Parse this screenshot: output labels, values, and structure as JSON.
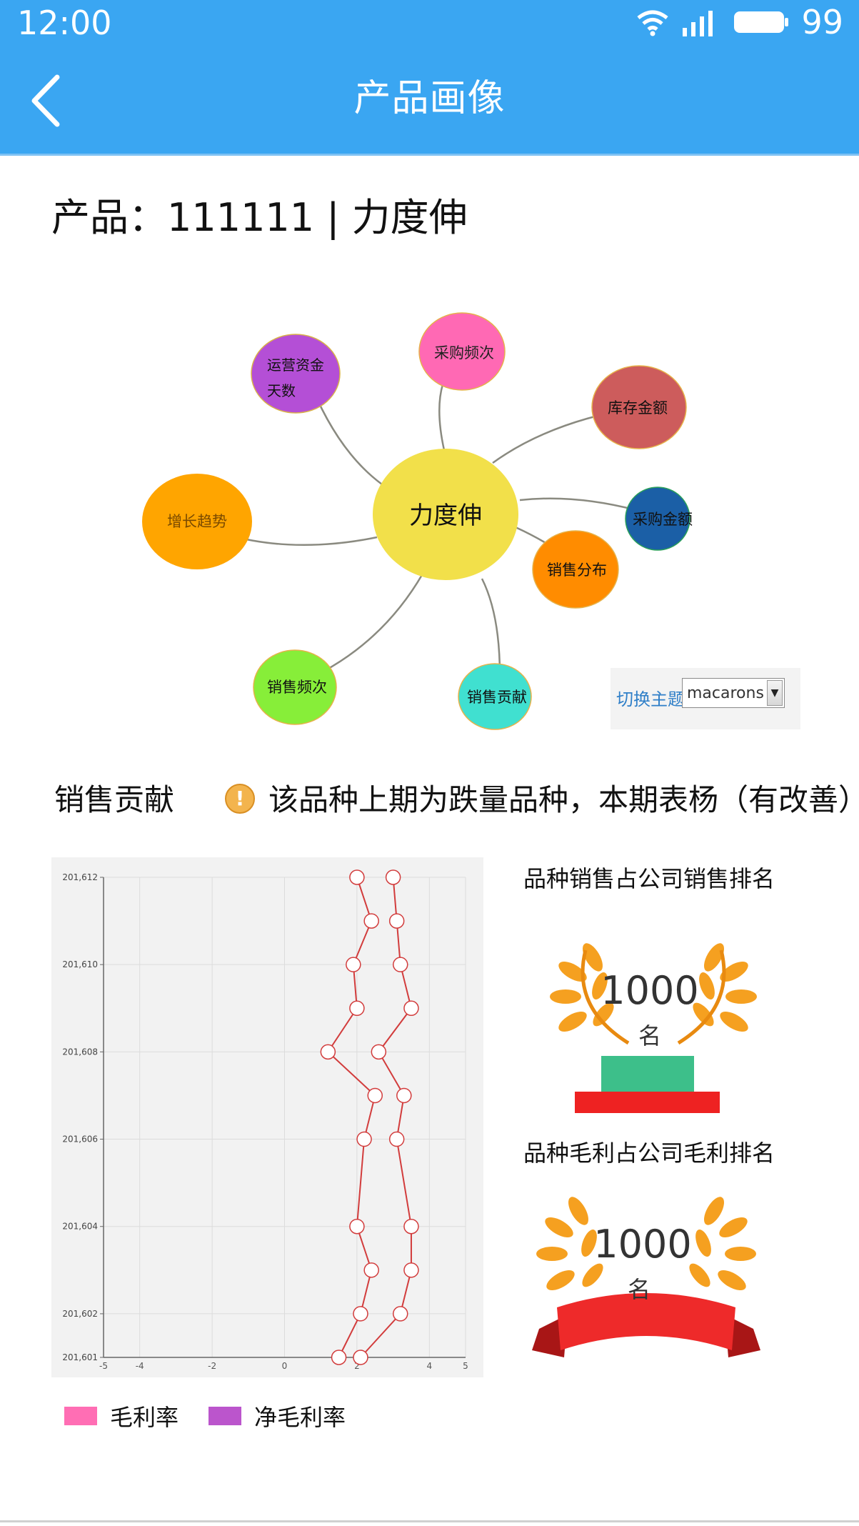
{
  "status_bar": {
    "time": "12:00",
    "battery": "99",
    "icons": [
      "wifi-icon",
      "signal-icon",
      "battery-icon"
    ]
  },
  "nav": {
    "title": "产品画像",
    "back_icon": "chevron-left-icon"
  },
  "product": {
    "prefix": "产品：",
    "code": "111111",
    "separator": " | ",
    "name": "力度伸"
  },
  "graph": {
    "center": "力度伸",
    "nodes": [
      {
        "label": "运营资金天数",
        "color": "#b44fd6"
      },
      {
        "label": "采购频次",
        "color": "#ff69b4"
      },
      {
        "label": "库存金额",
        "color": "#cd5c5c"
      },
      {
        "label": "增长趋势",
        "color": "#ffa500"
      },
      {
        "label": "采购金额",
        "color": "#1b5fa6"
      },
      {
        "label": "销售分布",
        "color": "#ff8c00"
      },
      {
        "label": "销售频次",
        "color": "#87ee39"
      },
      {
        "label": "销售贡献",
        "color": "#40e0d0"
      }
    ],
    "center_color": "#f2e04a"
  },
  "theme_switch": {
    "label": "切换主题",
    "value": "macarons"
  },
  "section": {
    "title": "销售贡献",
    "warning": "该品种上期为跌量品种，本期表杨（有改善）",
    "warning_icon": "exclamation-icon"
  },
  "chart_data": {
    "type": "line",
    "orientation": "horizontal",
    "y_ticks": [
      "201,612",
      "201,610",
      "201,608",
      "201,606",
      "201,604",
      "201,602",
      "201,601"
    ],
    "x_ticks": [
      "-5",
      "-4",
      "-2",
      "0",
      "2",
      "4",
      "5"
    ],
    "xlim": [
      -5,
      5
    ],
    "y": [
      201612,
      201611,
      201610,
      201609,
      201608,
      201607,
      201606,
      201604,
      201603,
      201602,
      201601
    ],
    "series": [
      {
        "name": "毛利率",
        "color": "#ff6eb4",
        "values": [
          2.0,
          2.4,
          1.9,
          2.0,
          1.2,
          2.5,
          2.2,
          2.0,
          2.4,
          2.1,
          1.5
        ]
      },
      {
        "name": "净毛利率",
        "color": "#bb55cc",
        "values": [
          3.0,
          3.1,
          3.2,
          3.5,
          2.6,
          3.3,
          3.1,
          3.5,
          3.5,
          3.2,
          2.1
        ]
      }
    ],
    "line_color": "#d23c3c"
  },
  "rankings": [
    {
      "title": "品种销售占公司销售排名",
      "number": "1000",
      "unit": "名"
    },
    {
      "title": "品种毛利占公司毛利排名",
      "number": "1000",
      "unit": "名"
    }
  ]
}
